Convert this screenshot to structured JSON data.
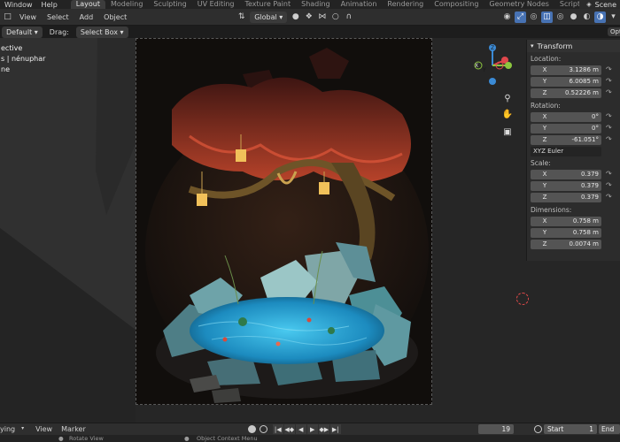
{
  "topbar": {
    "menus": [
      "Window",
      "Help"
    ],
    "tabs": [
      "Layout",
      "Modeling",
      "Sculpting",
      "UV Editing",
      "Texture Paint",
      "Shading",
      "Animation",
      "Rendering",
      "Compositing",
      "Geometry Nodes",
      "Scripting"
    ],
    "active_tab": "Layout",
    "scene_label": "Scene"
  },
  "header": {
    "menus": [
      "View",
      "Select",
      "Add",
      "Object"
    ],
    "orientation": "Global",
    "options_label": "Opt"
  },
  "tool_header": {
    "mode": "Default",
    "drag_label": "Drag:",
    "drag_value": "Select Box"
  },
  "viewport": {
    "overlay_lines": [
      "ective",
      "s | nénuphar",
      "ne"
    ]
  },
  "gizmo": {
    "x_label": "X",
    "y_label": "Y",
    "z_label": "Z"
  },
  "npanel": {
    "title": "Transform",
    "location_label": "Location:",
    "location": [
      {
        "axis": "X",
        "value": "3.1286 m"
      },
      {
        "axis": "Y",
        "value": "6.0085 m"
      },
      {
        "axis": "Z",
        "value": "0.52226 m"
      }
    ],
    "rotation_label": "Rotation:",
    "rotation": [
      {
        "axis": "X",
        "value": "0°"
      },
      {
        "axis": "Y",
        "value": "0°"
      },
      {
        "axis": "Z",
        "value": "-61.051°"
      }
    ],
    "rotation_mode": "XYZ Euler",
    "scale_label": "Scale:",
    "scale": [
      {
        "axis": "X",
        "value": "0.379"
      },
      {
        "axis": "Y",
        "value": "0.379"
      },
      {
        "axis": "Z",
        "value": "0.379"
      }
    ],
    "dimensions_label": "Dimensions:",
    "dimensions": [
      {
        "axis": "X",
        "value": "0.758 m"
      },
      {
        "axis": "Y",
        "value": "0.758 m"
      },
      {
        "axis": "Z",
        "value": "0.0074 m"
      }
    ]
  },
  "timeline": {
    "playback_label": "ying",
    "view_label": "View",
    "marker_label": "Marker",
    "current_frame": "19",
    "start_label": "Start",
    "start_value": "1",
    "end_label": "End"
  },
  "statusbar": {
    "left": "Rotate View",
    "middle": "Object Context Menu"
  },
  "colors": {
    "accent": "#4772b3",
    "axis_x": "#e0474c",
    "axis_y": "#8cc63f",
    "axis_z": "#3b8bd6",
    "water": "#2aa7d6",
    "canopy": "#8a2a1e"
  }
}
